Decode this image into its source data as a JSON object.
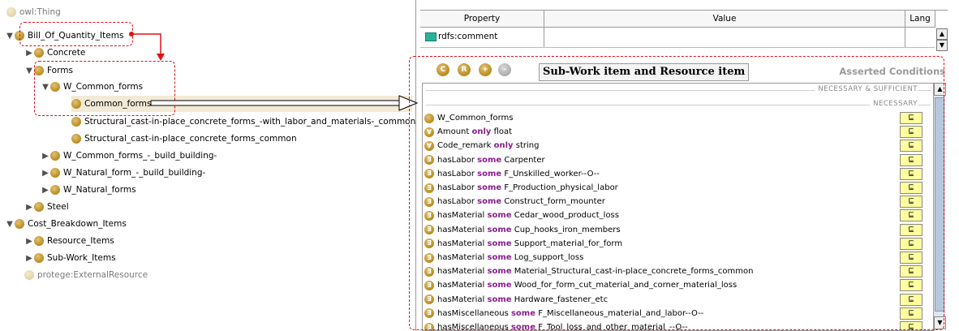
{
  "class_tree": [
    {
      "label": "owl:Thing"
    },
    {
      "label": "Bill_Of_Quantity_Items"
    },
    {
      "label": "Concrete"
    },
    {
      "label": "Forms"
    },
    {
      "label": "W_Common_forms"
    },
    {
      "label": "Common_forms"
    },
    {
      "label": "Structural_cast-in-place_concrete_forms_-with_labor_and_materials-_common"
    },
    {
      "label": "Structural_cast-in-place_concrete_forms_common"
    },
    {
      "label": "W_Common_forms_-_build_building-"
    },
    {
      "label": "W_Natural_form_-_build_building-"
    },
    {
      "label": "W_Natural_forms"
    },
    {
      "label": "Steel"
    },
    {
      "label": "Cost_Breakdown_Items"
    },
    {
      "label": "Resource_Items"
    },
    {
      "label": "Sub-Work_Items"
    },
    {
      "label": "protege:ExternalResource"
    }
  ],
  "annotations": {
    "headers": {
      "property": "Property",
      "value": "Value",
      "lang": "Lang"
    },
    "rows": [
      {
        "property": "rdfs:comment",
        "value": "",
        "lang": ""
      }
    ]
  },
  "conditions": {
    "heading": "Sub-Work item and Resource item",
    "asserted_label": "Asserted Conditions",
    "section_nec_suff": "NECESSARY & SUFFICIENT",
    "section_nec": "NECESSARY",
    "subclass_symbol": "⊑",
    "items": [
      {
        "icon": "",
        "property": "W_Common_forms",
        "keyword": "",
        "filler": ""
      },
      {
        "icon": "∀",
        "property": "Amount",
        "keyword": "only",
        "filler": "float"
      },
      {
        "icon": "∀",
        "property": "Code_remark",
        "keyword": "only",
        "filler": "string"
      },
      {
        "icon": "∃",
        "property": "hasLabor",
        "keyword": "some",
        "filler": "Carpenter"
      },
      {
        "icon": "∃",
        "property": "hasLabor",
        "keyword": "some",
        "filler": "F_Unskilled_worker--O--"
      },
      {
        "icon": "∃",
        "property": "hasLabor",
        "keyword": "some",
        "filler": "F_Production_physical_labor"
      },
      {
        "icon": "∃",
        "property": "hasLabor",
        "keyword": "some",
        "filler": "Construct_form_mounter"
      },
      {
        "icon": "∃",
        "property": "hasMaterial",
        "keyword": "some",
        "filler": "Cedar_wood_product_loss"
      },
      {
        "icon": "∃",
        "property": "hasMaterial",
        "keyword": "some",
        "filler": "Cup_hooks_iron_members"
      },
      {
        "icon": "∃",
        "property": "hasMaterial",
        "keyword": "some",
        "filler": "Support_material_for_form"
      },
      {
        "icon": "∃",
        "property": "hasMaterial",
        "keyword": "some",
        "filler": "Log_support_loss"
      },
      {
        "icon": "∃",
        "property": "hasMaterial",
        "keyword": "some",
        "filler": "Material_Structural_cast-in-place_concrete_forms_common"
      },
      {
        "icon": "∃",
        "property": "hasMaterial",
        "keyword": "some",
        "filler": "Wood_for_form_cut_material_and_corner_material_loss"
      },
      {
        "icon": "∃",
        "property": "hasMaterial",
        "keyword": "some",
        "filler": "Hardware_fastener_etc"
      },
      {
        "icon": "∃",
        "property": "hasMiscellaneous",
        "keyword": "some",
        "filler": "F_Miscellaneous_material_and_labor--O--"
      },
      {
        "icon": "∃",
        "property": "hasMiscellaneous",
        "keyword": "some",
        "filler": "F_Tool_loss_and_other_material_--O--"
      }
    ]
  },
  "toolbar_icons": [
    {
      "name": "create-class-icon",
      "glyph": "C"
    },
    {
      "name": "create-restriction-icon",
      "glyph": "R"
    },
    {
      "name": "add-named-class-icon",
      "glyph": "+"
    },
    {
      "name": "remove-condition-icon",
      "glyph": "-"
    }
  ],
  "colors": {
    "annotation_dash": "#e0101a",
    "keyword": "#8a1f8f",
    "subclass_button": "#ffffa0"
  }
}
